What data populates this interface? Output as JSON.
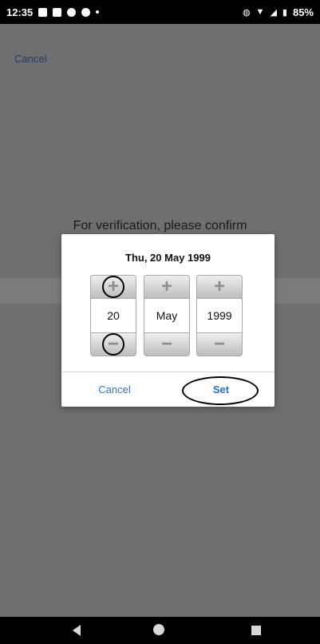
{
  "status_bar": {
    "time": "12:35",
    "battery": "85%",
    "icons": [
      "image-icon",
      "notes-icon",
      "messenger-icon",
      "messenger-icon",
      "dot-icon",
      "vibrate-icon",
      "wifi-icon",
      "signal-icon",
      "battery-icon"
    ]
  },
  "app": {
    "cancel_label": "Cancel",
    "verification_text": "For verification, please confirm"
  },
  "dialog": {
    "title": "Thu, 20 May 1999",
    "day": "20",
    "month": "May",
    "year": "1999",
    "plus_symbol": "+",
    "minus_symbol": "−",
    "cancel_label": "Cancel",
    "set_label": "Set"
  },
  "colors": {
    "dialog_button_blue": "#2a78c8",
    "overlay_gray": "#6f6f6f"
  },
  "nav_bar": {
    "icons": [
      "back-icon",
      "home-icon",
      "recents-icon"
    ]
  }
}
